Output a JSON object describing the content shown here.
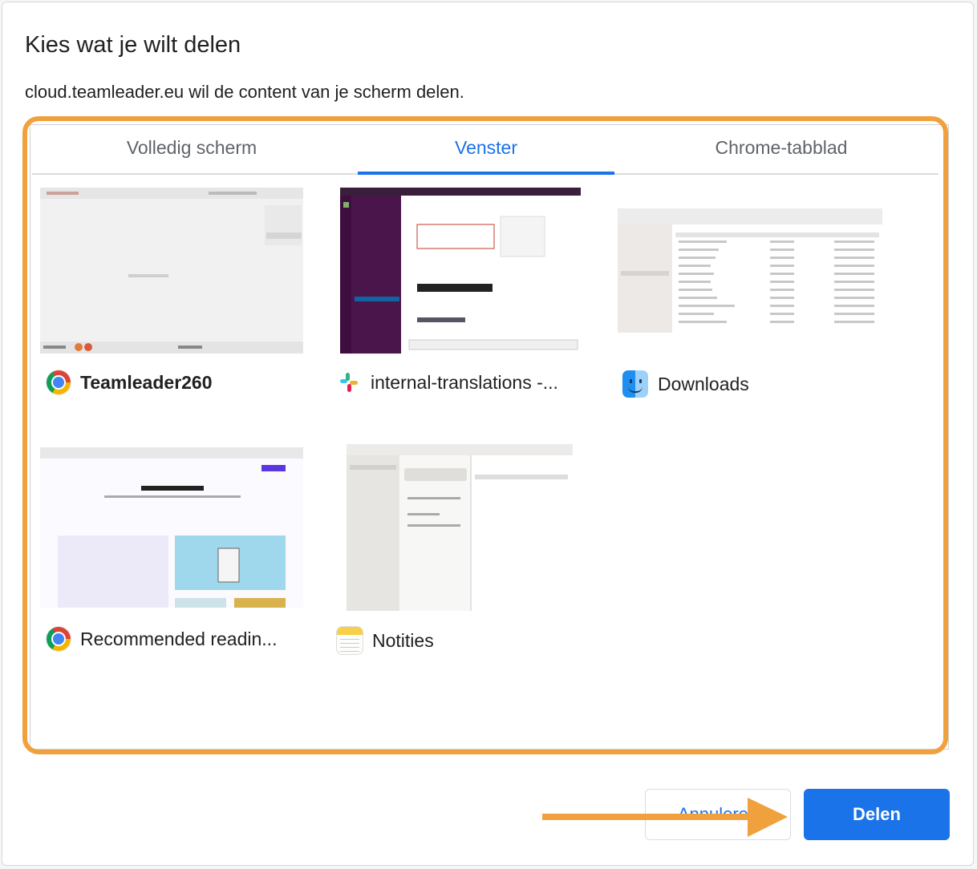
{
  "dialog": {
    "title": "Kies wat je wilt delen",
    "subtitle": "cloud.teamleader.eu wil de content van je scherm delen."
  },
  "tabs": [
    {
      "label": "Volledig scherm",
      "active": false
    },
    {
      "label": "Venster",
      "active": true
    },
    {
      "label": "Chrome-tabblad",
      "active": false
    }
  ],
  "sources": [
    {
      "title": "Teamleader260",
      "icon": "chrome-icon",
      "selected": true
    },
    {
      "title": "internal-translations -...",
      "icon": "slack-icon",
      "selected": false
    },
    {
      "title": "Downloads",
      "icon": "finder-icon",
      "selected": false
    },
    {
      "title": "Recommended readin...",
      "icon": "chrome-icon",
      "selected": false
    },
    {
      "title": "Notities",
      "icon": "notes-icon",
      "selected": false
    }
  ],
  "buttons": {
    "cancel_label": "Annuleren",
    "share_label": "Delen"
  },
  "colors": {
    "accent": "#1a73e8",
    "highlight": "#f0a13d"
  }
}
